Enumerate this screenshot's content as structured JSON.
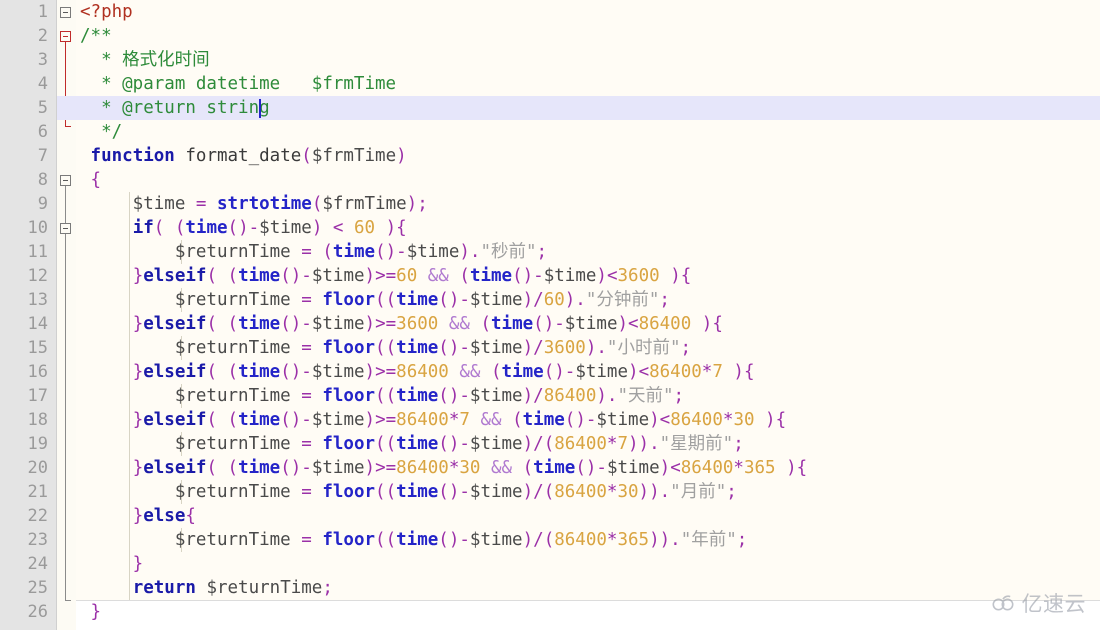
{
  "editor": {
    "language": "PHP",
    "total_lines": 26,
    "current_line": 5,
    "colors": {
      "background": "#fffcf5",
      "gutter": "#e4e4e4",
      "line_highlight": "#e6e6fa",
      "keyword": "#1a1aa8",
      "function": "#2424c8",
      "comment": "#2e8b3a",
      "string": "#a0a0a0",
      "number": "#d9a441",
      "punctuation": "#9b30a8",
      "php_tag": "#b03020",
      "variable": "#4a4a4a",
      "line_number": "#9a9a9a"
    }
  },
  "line_numbers": [
    "1",
    "2",
    "3",
    "4",
    "5",
    "6",
    "7",
    "8",
    "9",
    "10",
    "11",
    "12",
    "13",
    "14",
    "15",
    "16",
    "17",
    "18",
    "19",
    "20",
    "21",
    "22",
    "23",
    "24",
    "25",
    "26"
  ],
  "code_lines": [
    {
      "n": 1,
      "text": "<?php"
    },
    {
      "n": 2,
      "text": "/**"
    },
    {
      "n": 3,
      "text": " * 格式化时间"
    },
    {
      "n": 4,
      "text": " * @param datetime   $frmTime"
    },
    {
      "n": 5,
      "text": " * @return string"
    },
    {
      "n": 6,
      "text": " */"
    },
    {
      "n": 7,
      "text": "function format_date($frmTime)"
    },
    {
      "n": 8,
      "text": "{"
    },
    {
      "n": 9,
      "text": "    $time = strtotime($frmTime);"
    },
    {
      "n": 10,
      "text": "    if( (time()-$time) < 60 ){"
    },
    {
      "n": 11,
      "text": "        $returnTime = (time()-$time).\"秒前\";"
    },
    {
      "n": 12,
      "text": "    }elseif( (time()-$time)>=60 && (time()-$time)<3600 ){"
    },
    {
      "n": 13,
      "text": "        $returnTime = floor((time()-$time)/60).\"分钟前\";"
    },
    {
      "n": 14,
      "text": "    }elseif( (time()-$time)>=3600 && (time()-$time)<86400 ){"
    },
    {
      "n": 15,
      "text": "        $returnTime = floor((time()-$time)/3600).\"小时前\";"
    },
    {
      "n": 16,
      "text": "    }elseif( (time()-$time)>=86400 && (time()-$time)<86400*7 ){"
    },
    {
      "n": 17,
      "text": "        $returnTime = floor((time()-$time)/86400).\"天前\";"
    },
    {
      "n": 18,
      "text": "    }elseif( (time()-$time)>=86400*7 && (time()-$time)<86400*30 ){"
    },
    {
      "n": 19,
      "text": "        $returnTime = floor((time()-$time)/(86400*7)).\"星期前\";"
    },
    {
      "n": 20,
      "text": "    }elseif( (time()-$time)>=86400*30 && (time()-$time)<86400*365 ){"
    },
    {
      "n": 21,
      "text": "        $returnTime = floor((time()-$time)/(86400*30)).\"月前\";"
    },
    {
      "n": 22,
      "text": "    }else{"
    },
    {
      "n": 23,
      "text": "        $returnTime = floor((time()-$time)/(86400*365)).\"年前\";"
    },
    {
      "n": 24,
      "text": "    }"
    },
    {
      "n": 25,
      "text": "    return $returnTime;"
    },
    {
      "n": 26,
      "text": "}"
    }
  ],
  "fold_markers": [
    {
      "line": 1,
      "state": "expanded",
      "color": "gray"
    },
    {
      "line": 2,
      "state": "expanded",
      "color": "red"
    },
    {
      "line": 8,
      "state": "expanded",
      "color": "gray"
    },
    {
      "line": 10,
      "state": "expanded",
      "color": "gray"
    }
  ],
  "caret": {
    "line": 5,
    "column": 17
  },
  "watermark": {
    "text": "亿速云",
    "icon": "cloud-icon"
  }
}
